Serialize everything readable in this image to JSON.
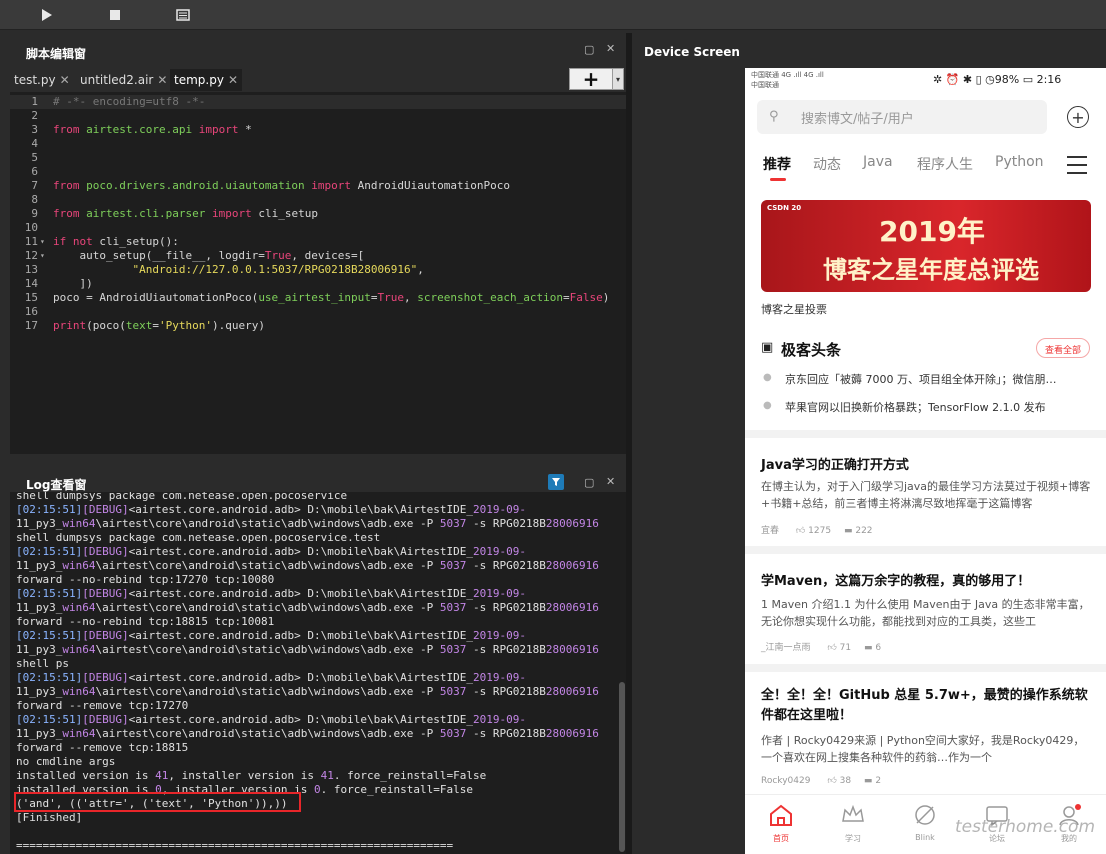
{
  "toolbar": {
    "icons": [
      "play-icon",
      "stop-icon",
      "report-icon"
    ]
  },
  "editor_panel": {
    "title": "脚本编辑窗",
    "tabs": [
      {
        "label": "test.py"
      },
      {
        "label": "untitled2.air"
      },
      {
        "label": "temp.py"
      }
    ],
    "add_label": "+",
    "dropdown_label": "▾",
    "code_lines": [
      {
        "num": "1",
        "text": "# -*- encoding=utf8 -*-"
      },
      {
        "num": "2",
        "text": ""
      },
      {
        "num": "3",
        "text": "from airtest.core.api import *"
      },
      {
        "num": "4",
        "text": ""
      },
      {
        "num": "5",
        "text": ""
      },
      {
        "num": "6",
        "text": ""
      },
      {
        "num": "7",
        "text": "from poco.drivers.android.uiautomation import AndroidUiautomationPoco"
      },
      {
        "num": "8",
        "text": ""
      },
      {
        "num": "9",
        "text": "from airtest.cli.parser import cli_setup"
      },
      {
        "num": "10",
        "text": ""
      },
      {
        "num": "11",
        "text": "if not cli_setup():"
      },
      {
        "num": "12",
        "text": "    auto_setup(__file__, logdir=True, devices=["
      },
      {
        "num": "13",
        "text": "            \"Android://127.0.0.1:5037/RPG0218B28006916\","
      },
      {
        "num": "14",
        "text": "    ])"
      },
      {
        "num": "15",
        "text": "poco = AndroidUiautomationPoco(use_airtest_input=True, screenshot_each_action=False)"
      },
      {
        "num": "16",
        "text": ""
      },
      {
        "num": "17",
        "text": "print(poco(text='Python').query)"
      }
    ]
  },
  "log_panel": {
    "title": "Log查看窗",
    "lines": [
      "shell dumpsys package com.netease.open.pocoservice",
      "[02:15:51][DEBUG]<airtest.core.android.adb> D:\\mobile\\bak\\AirtestIDE_2019-09-",
      "11_py3_win64\\airtest\\core\\android\\static\\adb\\windows\\adb.exe -P 5037 -s RPG0218B28006916",
      "shell dumpsys package com.netease.open.pocoservice.test",
      "[02:15:51][DEBUG]<airtest.core.android.adb> D:\\mobile\\bak\\AirtestIDE_2019-09-",
      "11_py3_win64\\airtest\\core\\android\\static\\adb\\windows\\adb.exe -P 5037 -s RPG0218B28006916",
      "forward --no-rebind tcp:17270 tcp:10080",
      "[02:15:51][DEBUG]<airtest.core.android.adb> D:\\mobile\\bak\\AirtestIDE_2019-09-",
      "11_py3_win64\\airtest\\core\\android\\static\\adb\\windows\\adb.exe -P 5037 -s RPG0218B28006916",
      "forward --no-rebind tcp:18815 tcp:10081",
      "[02:15:51][DEBUG]<airtest.core.android.adb> D:\\mobile\\bak\\AirtestIDE_2019-09-",
      "11_py3_win64\\airtest\\core\\android\\static\\adb\\windows\\adb.exe -P 5037 -s RPG0218B28006916",
      "shell ps",
      "[02:15:51][DEBUG]<airtest.core.android.adb> D:\\mobile\\bak\\AirtestIDE_2019-09-",
      "11_py3_win64\\airtest\\core\\android\\static\\adb\\windows\\adb.exe -P 5037 -s RPG0218B28006916",
      "forward --remove tcp:17270",
      "[02:15:51][DEBUG]<airtest.core.android.adb> D:\\mobile\\bak\\AirtestIDE_2019-09-",
      "11_py3_win64\\airtest\\core\\android\\static\\adb\\windows\\adb.exe -P 5037 -s RPG0218B28006916",
      "forward --remove tcp:18815",
      "no cmdline args",
      "installed version is 41, installer version is 41. force_reinstall=False",
      "installed version is 0, installer version is 0. force_reinstall=False",
      "('and', (('attr=', ('text', 'Python')),))",
      "[Finished]",
      "",
      "=================================================================="
    ]
  },
  "device_panel": {
    "title": "Device Screen"
  },
  "phone": {
    "status_left_1": "中国联通 4G .ıll 4G .ıll",
    "status_left_2": "中国联通",
    "status_right": "✲ ⏰ ✱ ▯ ◷98% ▭ 2:16",
    "search_placeholder": "搜索博文/帖子/用户",
    "nav_tabs": [
      "推荐",
      "动态",
      "Java",
      "程序人生",
      "Python"
    ],
    "banner_logo": "CSDN 20",
    "banner_year": "2019年",
    "banner_text": "博客之星年度总评选",
    "banner_caption": "博客之星投票",
    "headlines_title": "极客头条",
    "headlines_more": "查看全部",
    "headlines": [
      "京东回应「被薅 7000 万、项目组全体开除」；微信朋…",
      "苹果官网以旧换新价格暴跌；TensorFlow 2.1.0 发布"
    ],
    "articles": [
      {
        "title": "Java学习的正确打开方式",
        "desc": "在博主认为，对于入门级学习java的最佳学习方法莫过于视频+博客+书籍+总结，前三者博主将淋漓尽致地挥毫于这篇博客",
        "author": "宜春",
        "likes": "1275",
        "comments": "222"
      },
      {
        "title": "学Maven，这篇万余字的教程，真的够用了！",
        "desc": "1 Maven 介绍1.1 为什么使用 Maven由于 Java 的生态非常丰富，无论你想实现什么功能，都能找到对应的工具类，这些工",
        "author": "_江南一点雨",
        "likes": "71",
        "comments": "6"
      },
      {
        "title": "全！全！全！GitHub 总星 5.7w+，最赞的操作系统软件都在这里啦！",
        "desc": "作者 | Rocky0429来源 | Python空间大家好，我是Rocky0429，一个喜欢在网上搜集各种软件的药翁…作为一个",
        "author": "Rocky0429",
        "likes": "38",
        "comments": "2"
      }
    ],
    "bottom_nav": [
      {
        "label": "首页",
        "icon": "home-icon"
      },
      {
        "label": "学习",
        "icon": "crown-icon"
      },
      {
        "label": "Blink",
        "icon": "blink-icon"
      },
      {
        "label": "论坛",
        "icon": "chat-icon"
      },
      {
        "label": "我的",
        "icon": "profile-icon"
      }
    ],
    "watermark": "testerhome.com"
  }
}
